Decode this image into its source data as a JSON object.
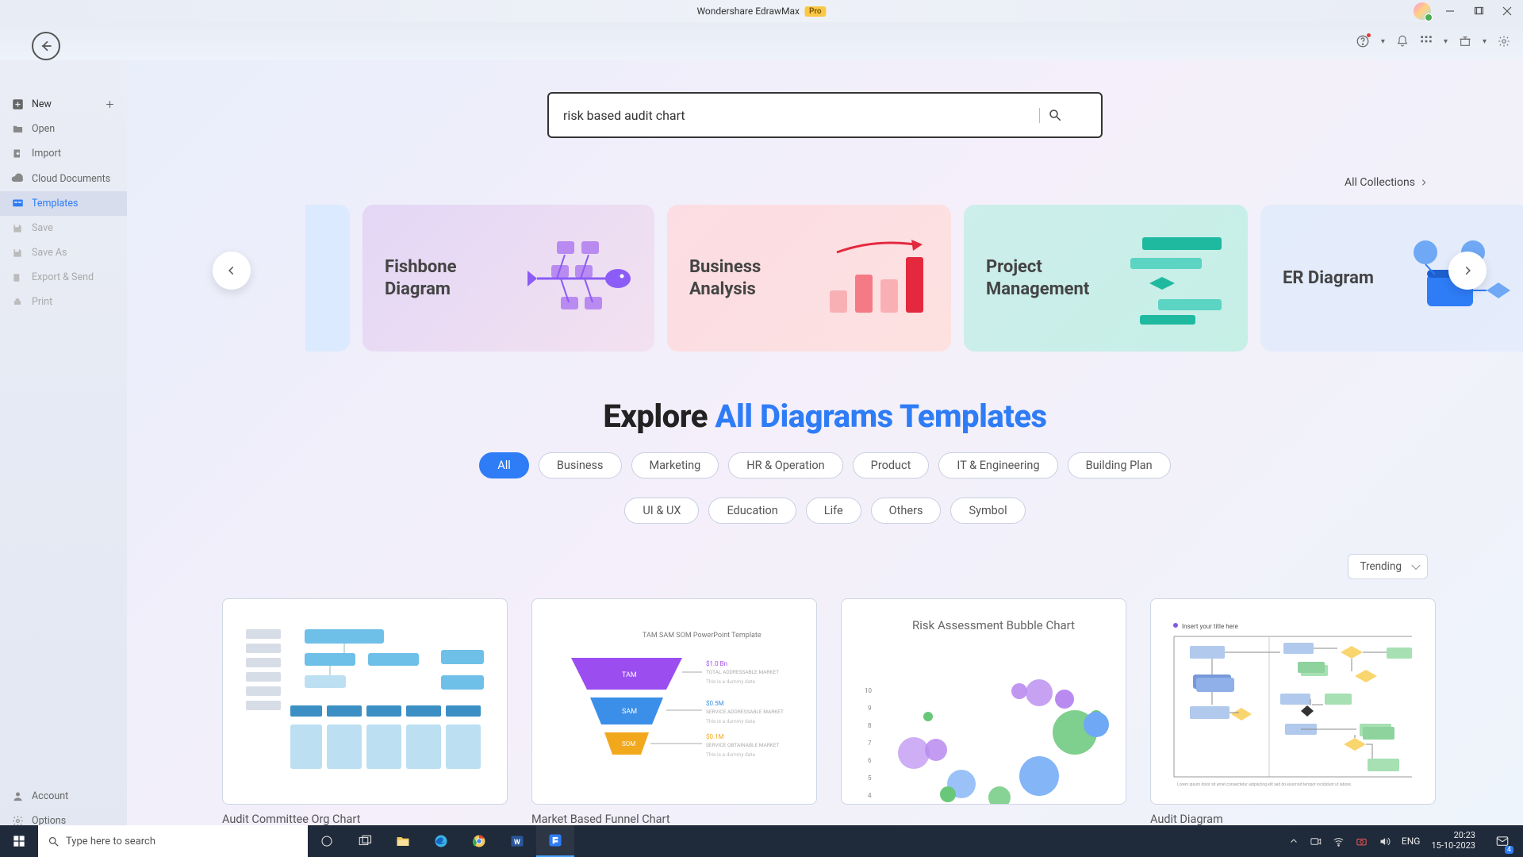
{
  "titlebar": {
    "app": "Wondershare EdrawMax",
    "pro": "Pro"
  },
  "back_aria": "Back",
  "sidebar": {
    "new": "New",
    "open": "Open",
    "import": "Import",
    "cloud": "Cloud Documents",
    "templates": "Templates",
    "save": "Save",
    "saveas": "Save As",
    "export": "Export & Send",
    "print": "Print",
    "account": "Account",
    "options": "Options"
  },
  "search": {
    "value": "risk based audit chart"
  },
  "all_collections": "All Collections",
  "cards": {
    "fish": "Fishbone Diagram",
    "biz": "Business Analysis",
    "pm": "Project Management",
    "er": "ER Diagram"
  },
  "explore": {
    "lead": "Explore ",
    "blue": "All Diagrams Templates"
  },
  "filters": [
    "All",
    "Business",
    "Marketing",
    "HR & Operation",
    "Product",
    "IT & Engineering",
    "Building Plan",
    "UI & UX",
    "Education",
    "Life",
    "Others",
    "Symbol"
  ],
  "trending": "Trending",
  "templates": {
    "t1": "Audit Committee Org Chart",
    "t2": "Market Based Funnel Chart",
    "t3": "Risk Assessment Bubble Chart",
    "t4": "Audit Diagram",
    "funnel_caption": "TAM SAM SOM PowerPoint Template",
    "audit_caption": "Insert your title here"
  },
  "taskbar": {
    "search_placeholder": "Type here to search",
    "ime": "ENG",
    "time": "20:23",
    "date": "15-10-2023",
    "mail_count": "4"
  }
}
